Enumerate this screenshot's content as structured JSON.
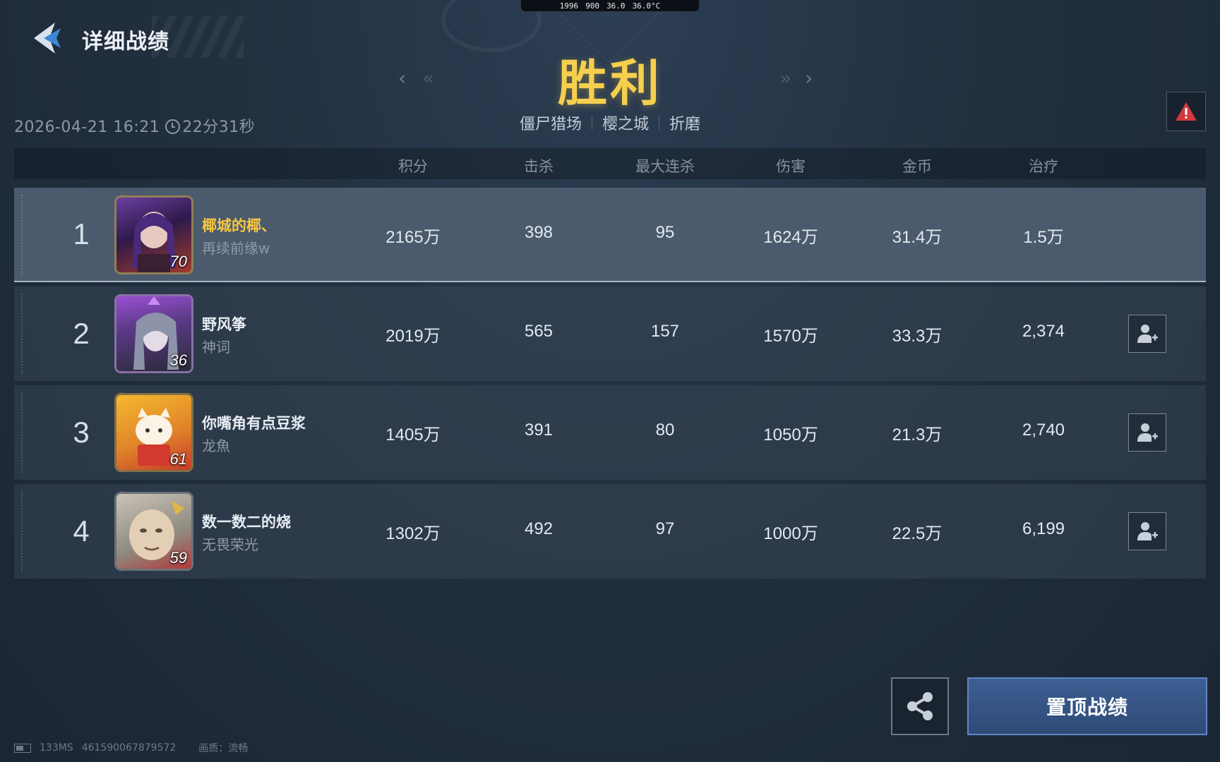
{
  "status_bar": {
    "item1": "1996",
    "item2": "900",
    "item3": "36.0",
    "item4": "36.0°C"
  },
  "header": {
    "title": "详细战绩",
    "datetime": "2026-04-21 16:21",
    "duration": "22分31秒"
  },
  "result": {
    "title": "胜利",
    "mode": "僵尸猎场",
    "map": "樱之城",
    "difficulty": "折磨"
  },
  "columns": [
    "积分",
    "击杀",
    "最大连杀",
    "伤害",
    "金币",
    "治疗"
  ],
  "players": [
    {
      "rank": "1",
      "name": "椰城的椰、",
      "title": "再续前缘w",
      "level": "70",
      "score": "2165万",
      "kills": "398",
      "max_streak": "95",
      "damage": "1624万",
      "gold": "31.4万",
      "heal": "1.5万",
      "is_self": true
    },
    {
      "rank": "2",
      "name": "野风筝",
      "title": "神词",
      "level": "36",
      "score": "2019万",
      "kills": "565",
      "max_streak": "157",
      "damage": "1570万",
      "gold": "33.3万",
      "heal": "2,374",
      "is_self": false
    },
    {
      "rank": "3",
      "name": "你嘴角有点豆浆",
      "title": "龙魚",
      "level": "61",
      "score": "1405万",
      "kills": "391",
      "max_streak": "80",
      "damage": "1050万",
      "gold": "21.3万",
      "heal": "2,740",
      "is_self": false
    },
    {
      "rank": "4",
      "name": "数一数二的烧",
      "title": "无畏荣光",
      "level": "59",
      "score": "1302万",
      "kills": "492",
      "max_streak": "97",
      "damage": "1000万",
      "gold": "22.5万",
      "heal": "6,199",
      "is_self": false
    }
  ],
  "buttons": {
    "pin": "置顶战绩"
  },
  "footer": {
    "ping": "133MS",
    "id": "461590067879572",
    "quality": "画质：流畅"
  },
  "colors": {
    "victory": "#f5cf4e",
    "self_name": "#f4c744",
    "pin_button": "#3e5f93"
  },
  "icons": [
    "back-arrow-icon",
    "clock-icon",
    "warning-icon",
    "add-friend-icon",
    "share-icon",
    "battery-icon"
  ]
}
